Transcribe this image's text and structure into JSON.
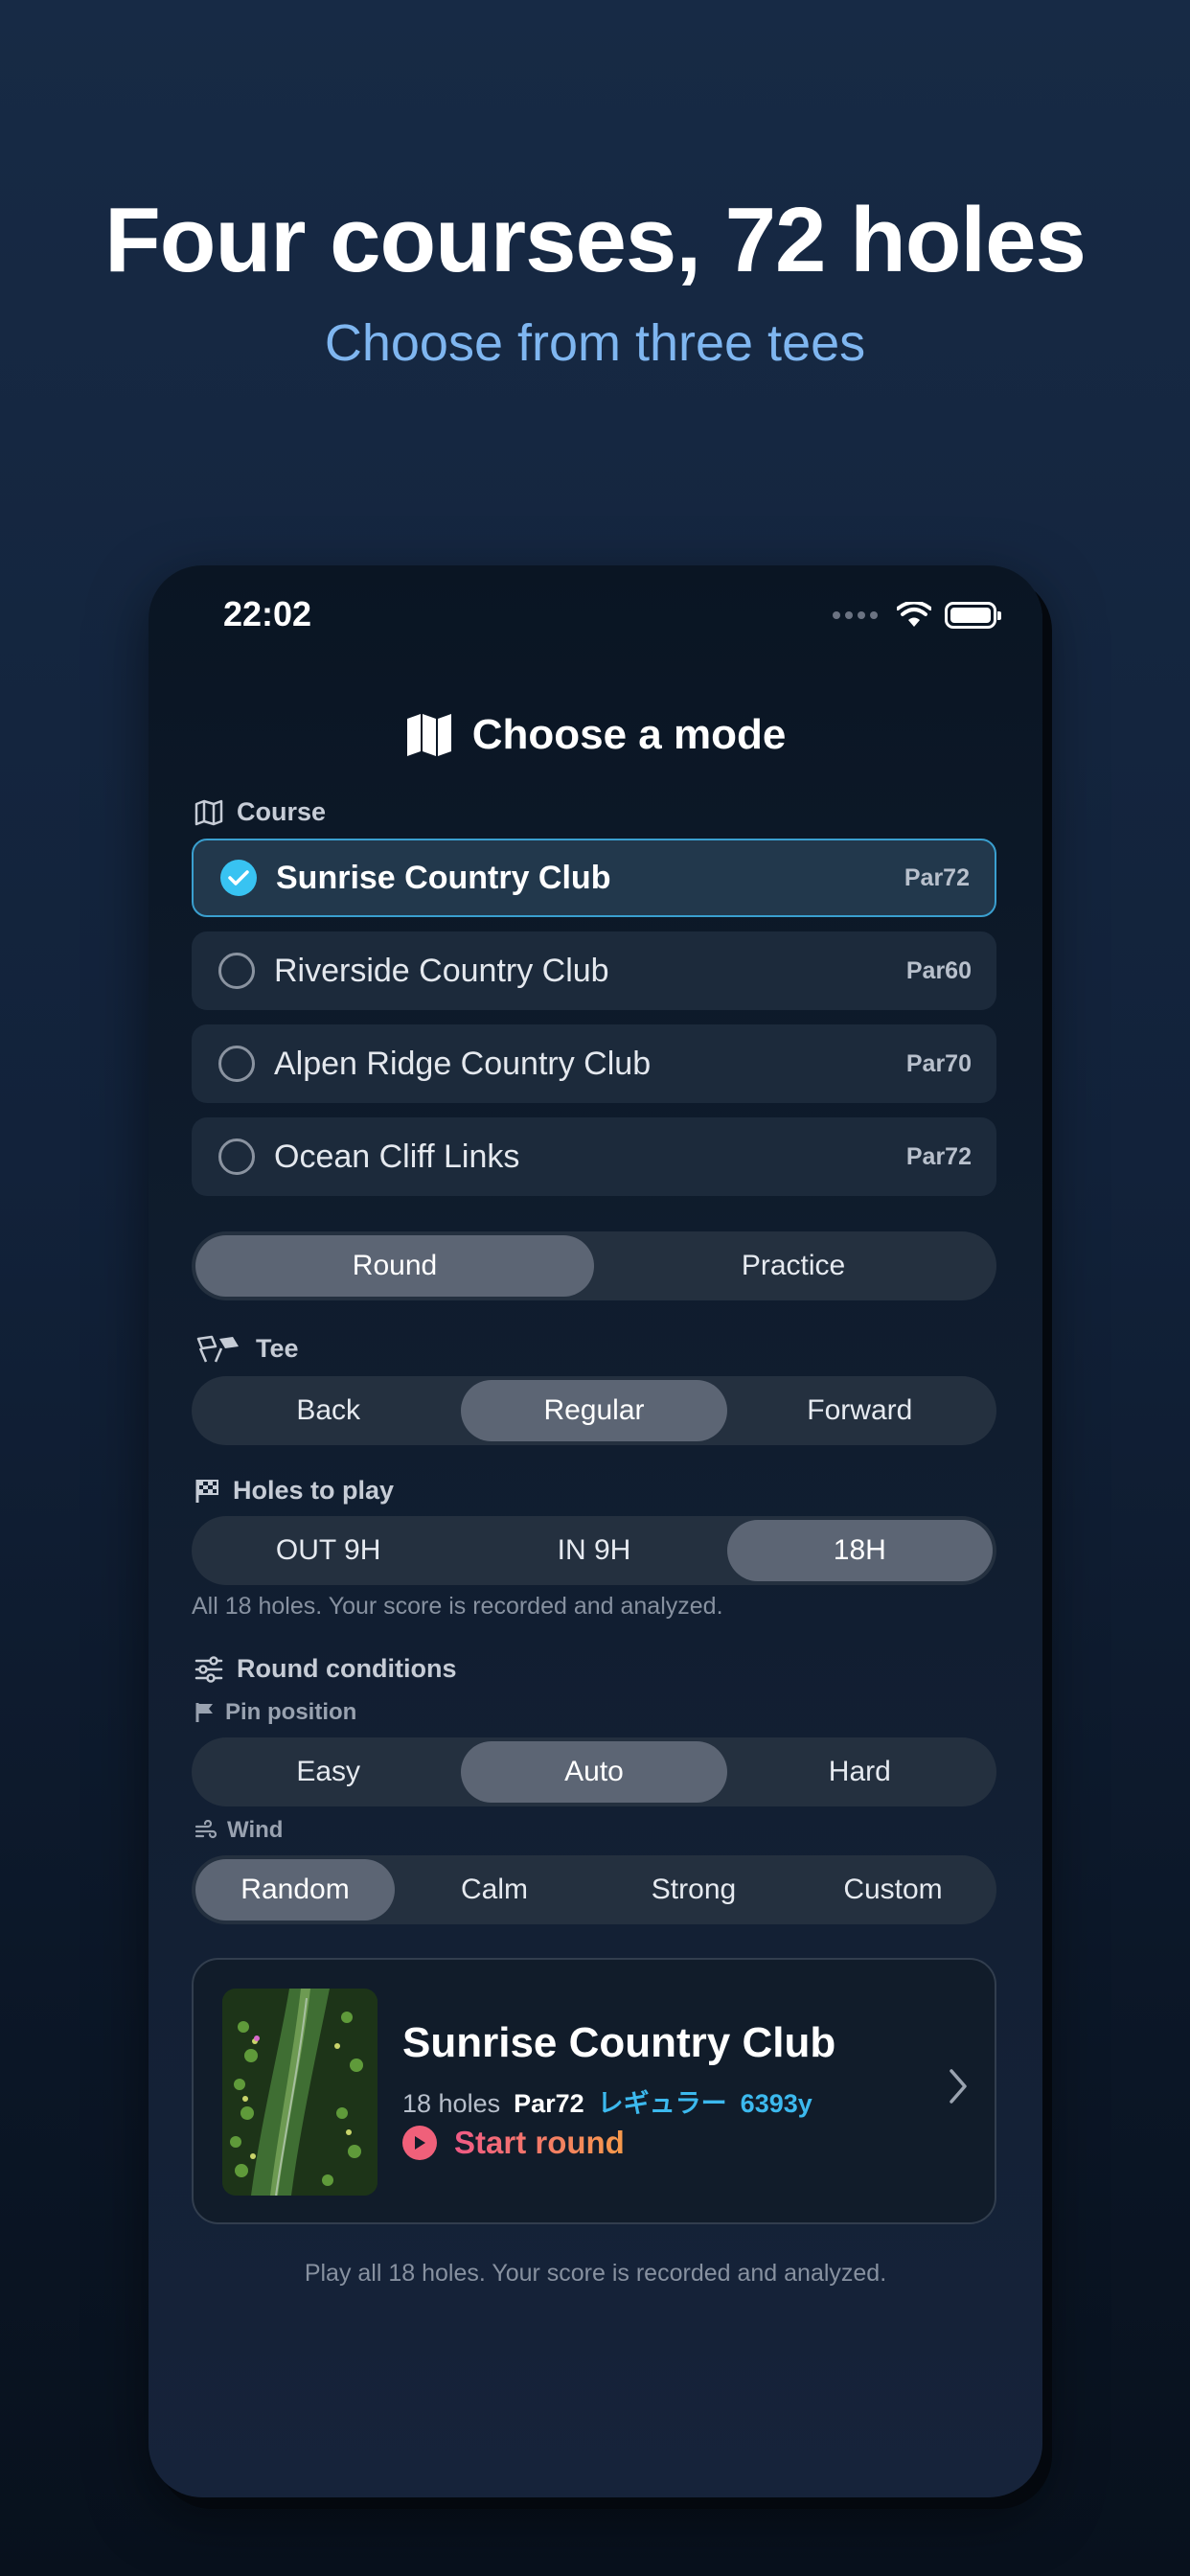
{
  "hero": {
    "title": "Four courses, 72 holes",
    "subtitle": "Choose from three tees"
  },
  "status_bar": {
    "time": "22:02"
  },
  "header": {
    "title": "Choose a mode",
    "icon": "map-icon"
  },
  "course_section": {
    "label": "Course",
    "courses": [
      {
        "name": "Sunrise Country Club",
        "par": "Par72",
        "selected": true
      },
      {
        "name": "Riverside Country Club",
        "par": "Par60",
        "selected": false
      },
      {
        "name": "Alpen Ridge Country Club",
        "par": "Par70",
        "selected": false
      },
      {
        "name": "Ocean Cliff Links",
        "par": "Par72",
        "selected": false
      }
    ]
  },
  "mode_tabs": {
    "options": [
      "Round",
      "Practice"
    ],
    "selected": "Round"
  },
  "tee_section": {
    "label": "Tee",
    "options": [
      "Back",
      "Regular",
      "Forward"
    ],
    "selected": "Regular"
  },
  "holes_section": {
    "label": "Holes to play",
    "options": [
      "OUT 9H",
      "IN 9H",
      "18H"
    ],
    "selected": "18H",
    "hint": "All 18 holes. Your score is recorded and analyzed."
  },
  "conditions_section": {
    "label": "Round conditions",
    "pin": {
      "label": "Pin position",
      "options": [
        "Easy",
        "Auto",
        "Hard"
      ],
      "selected": "Auto"
    },
    "wind": {
      "label": "Wind",
      "options": [
        "Random",
        "Calm",
        "Strong",
        "Custom"
      ],
      "selected": "Random"
    }
  },
  "summary_card": {
    "course_name": "Sunrise Country Club",
    "holes": "18 holes",
    "par": "Par72",
    "tee": "レギュラー",
    "yardage": "6393y",
    "start_label": "Start round"
  },
  "footer_note": "Play all 18 holes. Your score is recorded and analyzed.",
  "colors": {
    "accent_cyan": "#38c3f2",
    "start_gradient_from": "#f05a85",
    "start_gradient_to": "#f79a4a",
    "hero_subtitle": "#7fb6f0"
  }
}
